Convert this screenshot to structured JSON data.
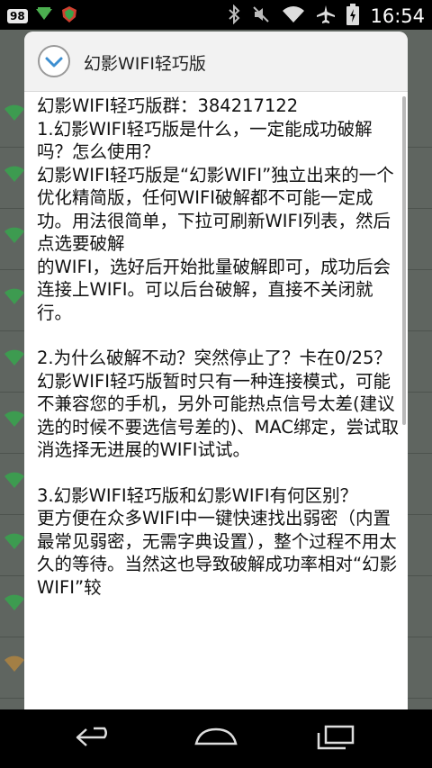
{
  "status_bar": {
    "notif_count": "98",
    "time": "16:54",
    "icons": [
      "notification-count-icon",
      "download-icon",
      "app-shield-icon",
      "bluetooth-icon",
      "mute-icon",
      "wifi-signal-icon",
      "airplane-mode-icon",
      "battery-charging-icon"
    ]
  },
  "dialog": {
    "title": "幻影WIFI轻巧版",
    "header_icon": "chevron-down-circle-icon",
    "body": {
      "group": "幻影WIFI轻巧版群：384217122",
      "q1": "1.幻影WIFI轻巧版是什么，一定能成功破解吗？怎么使用？",
      "a1": "幻影WIFI轻巧版是“幻影WIFI”独立出来的一个优化精简版，任何WIFI破解都不可能一定成功。用法很简单，下拉可刷新WIFI列表，然后点选要破解\n的WIFI，选好后开始批量破解即可，成功后会连接上WIFI。可以后台破解，直接不关闭就行。",
      "q2": "2.为什么破解不动？突然停止了？卡在0/25？",
      "a2": "幻影WIFI轻巧版暂时只有一种连接模式，可能不兼容您的手机，另外可能热点信号太差(建议选的时候不要选信号差的)、MAC绑定，尝试取消选择无进展的WIFI试试。",
      "q3": "3.幻影WIFI轻巧版和幻影WIFI有何区别？",
      "a3": "更方便在众多WIFI中一键快速找出弱密（内置最常见弱密，无需字典设置），整个过程不用太久的等待。当然这也导致破解成功率相对“幻影WIFI”较"
    }
  },
  "nav_bar": {
    "buttons": [
      "back-icon",
      "home-icon",
      "recent-apps-icon"
    ]
  },
  "colors": {
    "wifi_green": "#2fb24a",
    "dialog_header_bg": "#f2f2f2",
    "chevron_blue": "#3d8fd1"
  }
}
